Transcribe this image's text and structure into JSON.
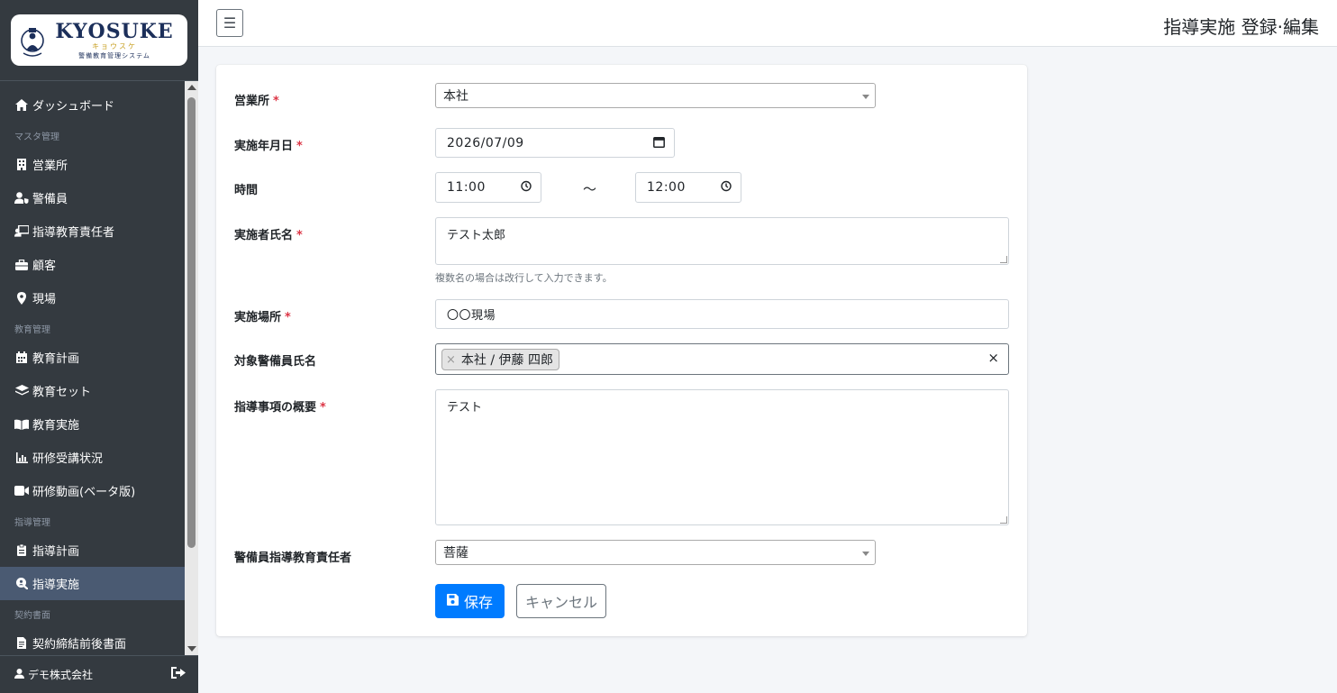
{
  "brand": {
    "name": "KYOSUKE",
    "kana": "キョウスケ",
    "subtitle": "警備教育管理システム"
  },
  "sidebar": {
    "items": [
      {
        "type": "item",
        "label": "ダッシュボード",
        "icon": "home-icon"
      },
      {
        "type": "header",
        "label": "マスタ管理"
      },
      {
        "type": "item",
        "label": "営業所",
        "icon": "building-icon"
      },
      {
        "type": "item",
        "label": "警備員",
        "icon": "user-shield-icon"
      },
      {
        "type": "item",
        "label": "指導教育責任者",
        "icon": "chalkboard-teacher-icon"
      },
      {
        "type": "item",
        "label": "顧客",
        "icon": "briefcase-icon"
      },
      {
        "type": "item",
        "label": "現場",
        "icon": "map-marker-icon"
      },
      {
        "type": "header",
        "label": "教育管理"
      },
      {
        "type": "item",
        "label": "教育計画",
        "icon": "calendar-icon"
      },
      {
        "type": "item",
        "label": "教育セット",
        "icon": "layer-group-icon"
      },
      {
        "type": "item",
        "label": "教育実施",
        "icon": "book-open-icon"
      },
      {
        "type": "item",
        "label": "研修受講状況",
        "icon": "chart-bar-icon"
      },
      {
        "type": "item",
        "label": "研修動画(ベータ版)",
        "icon": "video-icon"
      },
      {
        "type": "header",
        "label": "指導管理"
      },
      {
        "type": "item",
        "label": "指導計画",
        "icon": "clipboard-icon"
      },
      {
        "type": "item",
        "label": "指導実施",
        "icon": "search-user-icon",
        "active": true
      },
      {
        "type": "header",
        "label": "契約書面"
      },
      {
        "type": "item",
        "label": "契約締結前後書面",
        "icon": "file-contract-icon"
      }
    ],
    "footer_user": "デモ株式会社"
  },
  "header": {
    "menu_toggle_glyph": "☰",
    "title": "指導実施 登録·編集"
  },
  "form": {
    "office": {
      "label": "営業所",
      "value": "本社",
      "required": true
    },
    "date": {
      "label": "実施年月日",
      "value": "2026/07/09",
      "required": true
    },
    "time": {
      "label": "時間",
      "start": "11:00",
      "end": "12:00",
      "separator": "～"
    },
    "implementer": {
      "label": "実施者氏名",
      "value": "テスト太郎",
      "help": "複数名の場合は改行して入力できます。",
      "required": true
    },
    "place": {
      "label": "実施場所",
      "value": "〇〇現場",
      "required": true
    },
    "guards": {
      "label": "対象警備員氏名",
      "tags": [
        "本社 / 伊藤 四郎"
      ]
    },
    "summary": {
      "label": "指導事項の概要",
      "value": "テスト",
      "required": true
    },
    "manager": {
      "label": "警備員指導教育責任者",
      "value": "菩薩"
    },
    "required_mark": "*"
  },
  "buttons": {
    "save": "保存",
    "cancel": "キャンセル"
  },
  "colors": {
    "sidebar_bg": "#343a40",
    "primary": "#007bff",
    "required": "#dc3545"
  }
}
